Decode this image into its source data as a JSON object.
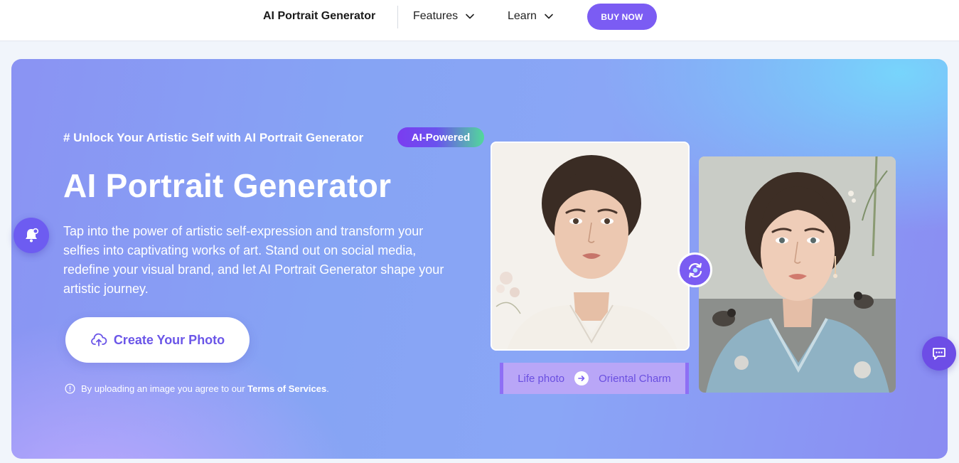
{
  "nav": {
    "brand": "AI Portrait Generator",
    "features_label": "Features",
    "learn_label": "Learn",
    "buy_label": "BUY NOW"
  },
  "hero": {
    "eyebrow": "# Unlock Your Artistic Self with AI Portrait Generator",
    "badge": "AI-Powered",
    "title": "AI Portrait Generator",
    "description": "Tap into the power of artistic self-expression and transform your selfies into captivating works of art. Stand out on social media, redefine your visual brand, and let AI Portrait Generator shape your artistic journey.",
    "cta_label": "Create Your Photo",
    "notice_prefix": "By uploading an image you agree to our",
    "notice_link": "Terms of Services",
    "notice_suffix": "."
  },
  "preview": {
    "before_label": "Life photo",
    "after_label": "Oriental Charm"
  },
  "colors": {
    "accent": "#7b5cf3",
    "cta_text": "#6b56e8",
    "badge_start": "#7b3cf0",
    "badge_end": "#52d99a"
  },
  "icons": {
    "nav_chevron": "chevron-down-icon",
    "cta": "cloud-upload-icon",
    "notice": "info-icon",
    "float_left": "bell-icon",
    "swap": "swap-icon",
    "arrow": "arrow-right-icon",
    "chat": "chat-icon"
  }
}
